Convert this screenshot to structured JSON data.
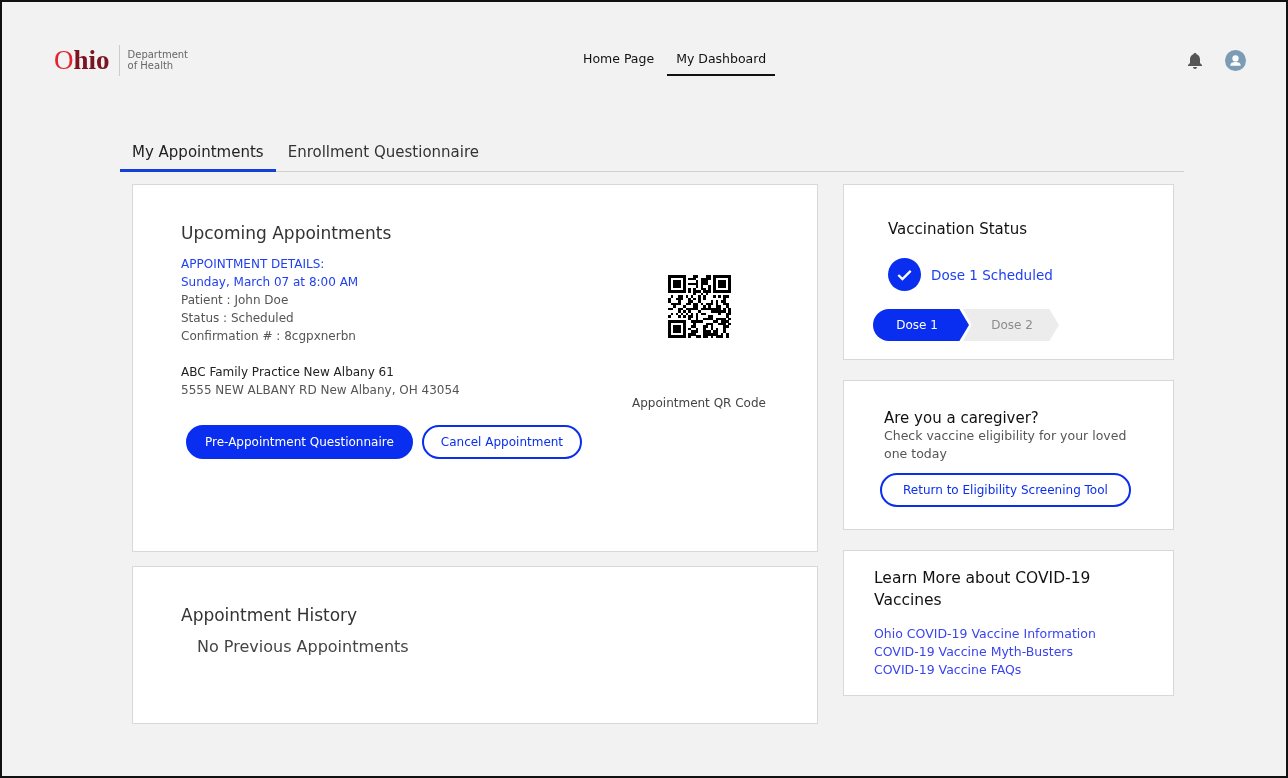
{
  "header": {
    "logo": {
      "word": "Ohio",
      "line_1": "Department",
      "line_2": "of Health"
    },
    "nav": [
      {
        "label": "Home Page",
        "selected": false
      },
      {
        "label": "My Dashboard",
        "selected": true
      }
    ]
  },
  "tabs": [
    {
      "label": "My Appointments",
      "selected": true
    },
    {
      "label": "Enrollment Questionnaire",
      "selected": false
    }
  ],
  "upcoming": {
    "title": "Upcoming Appointments",
    "details_heading": "APPOINTMENT DETAILS:",
    "datetime": "Sunday, March 07 at 8:00 AM",
    "lines": [
      "Patient : John Doe",
      "Status : Scheduled",
      "Confirmation # : 8cgpxnerbn"
    ],
    "location_name": "ABC Family Practice New Albany 61",
    "address": "5555 NEW ALBANY RD New Albany, OH 43054",
    "qr_caption": "Appointment QR Code",
    "buttons": [
      {
        "label": "Pre-Appointment Questionnaire",
        "kind": "primary"
      },
      {
        "label": "Cancel Appointment",
        "kind": "outline"
      }
    ]
  },
  "history": {
    "title": "Appointment History",
    "empty_text": "No Previous Appointments"
  },
  "vaccination_status": {
    "title": "Vaccination Status",
    "status": "Dose 1 Scheduled",
    "steps": [
      {
        "label": "Dose 1",
        "selected": true
      },
      {
        "label": "Dose 2",
        "selected": false
      }
    ]
  },
  "caregiver": {
    "title": "Are you a caregiver?",
    "text": "Check vaccine eligibility for your loved one today",
    "button": "Return to Eligibility Screening Tool"
  },
  "learn_more": {
    "title": "Learn More about COVID-19 Vaccines",
    "links": [
      "Ohio COVID-19 Vaccine Information",
      "COVID-19 Vaccine Myth-Busters",
      "COVID-19 Vaccine FAQs"
    ]
  }
}
